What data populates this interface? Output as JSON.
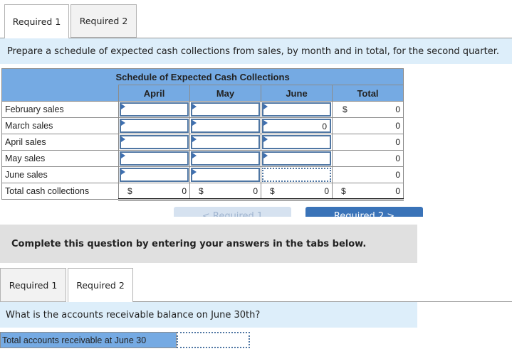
{
  "top_tabs": [
    {
      "label": "Required 1",
      "active": true
    },
    {
      "label": "Required 2",
      "active": false
    }
  ],
  "instruction": "Prepare a schedule of expected cash collections from sales, by month and in total, for the second quarter.",
  "schedule": {
    "title": "Schedule of Expected Cash Collections",
    "columns": [
      "April",
      "May",
      "June",
      "Total"
    ],
    "rows": [
      {
        "label": "February sales",
        "april": "",
        "may": "",
        "june": "",
        "total_prefix": "$",
        "total": "0"
      },
      {
        "label": "March sales",
        "april": "",
        "may": "",
        "june": "0",
        "total_prefix": "",
        "total": "0"
      },
      {
        "label": "April sales",
        "april": "",
        "may": "",
        "june": "",
        "total_prefix": "",
        "total": "0"
      },
      {
        "label": "May sales",
        "april": "",
        "may": "",
        "june": "",
        "total_prefix": "",
        "total": "0"
      },
      {
        "label": "June sales",
        "april": "",
        "may": "",
        "june": "",
        "total_prefix": "",
        "total": "0"
      }
    ],
    "total_row": {
      "label": "Total cash collections",
      "currency": "$",
      "april": "0",
      "may": "0",
      "june": "0",
      "total": "0"
    }
  },
  "nav": {
    "prev_label": "< Required 1",
    "next_label": "Required 2 >"
  },
  "notice": "Complete this question by entering your answers in the tabs below.",
  "bottom_tabs": [
    {
      "label": "Required 1",
      "active": false
    },
    {
      "label": "Required 2",
      "active": true
    }
  ],
  "question": "What is the accounts receivable balance on June 30th?",
  "ar": {
    "label": "Total accounts receivable at June 30",
    "value": ""
  }
}
